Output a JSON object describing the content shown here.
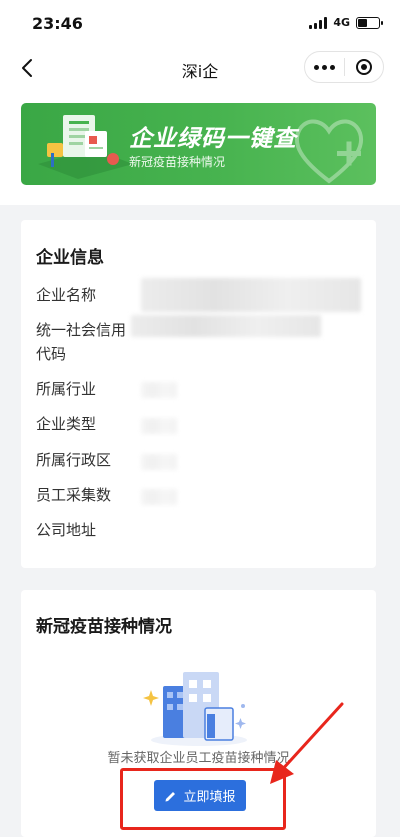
{
  "status_bar": {
    "time": "23:46",
    "network": "4G",
    "icons": [
      "signal-icon",
      "battery-icon"
    ]
  },
  "nav": {
    "title": "深i企",
    "back_icon": "chevron-left-icon",
    "menu_icon": "more-dots-icon",
    "close_icon": "target-circle-icon"
  },
  "banner": {
    "title": "企业绿码一键查",
    "subtitle": "新冠疫苗接种情况",
    "color": "#47b34f"
  },
  "company_info": {
    "title": "企业信息",
    "fields": [
      {
        "label": "企业名称"
      },
      {
        "label": "统一社会信用代码"
      },
      {
        "label": "所属行业"
      },
      {
        "label": "企业类型"
      },
      {
        "label": "所属行政区"
      },
      {
        "label": "员工采集数"
      },
      {
        "label": "公司地址"
      }
    ]
  },
  "vaccination": {
    "title": "新冠疫苗接种情况",
    "empty_text": "暂未获取企业员工疫苗接种情况",
    "fill_button": "立即填报",
    "button_color": "#2c6fdd"
  },
  "annotation": {
    "highlight_color": "#e8261c"
  }
}
